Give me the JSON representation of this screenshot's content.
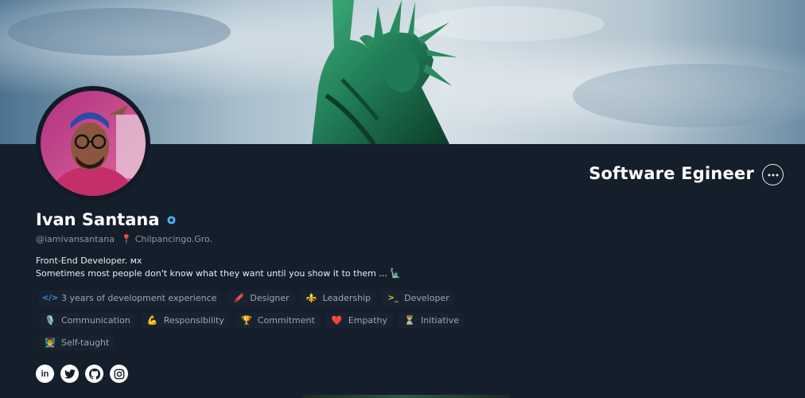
{
  "profile": {
    "name": "Ivan Santana",
    "handle": "@iamivansantana",
    "location": "Chilpancingo.Gro.",
    "role": "Software Egineer"
  },
  "bio": {
    "line1": "Front-End Developer. ᴍx",
    "line2": "Sometimes most people don't know what they want until you show it to them ... 🗽"
  },
  "badges_row1": [
    {
      "icon": "</>",
      "icon_name": "code-icon",
      "label": "3 years of development experience"
    },
    {
      "icon": "🖍️",
      "icon_name": "pencil-icon",
      "label": "Designer"
    },
    {
      "icon": "⚜️",
      "icon_name": "fleur-de-lis-icon",
      "label": "Leadership"
    },
    {
      "icon": ">_",
      "icon_name": "terminal-icon",
      "label": "Developer"
    }
  ],
  "badges_row2": [
    {
      "icon": "🎙️",
      "icon_name": "microphone-icon",
      "label": "Communication"
    },
    {
      "icon": "💪",
      "icon_name": "flexed-biceps-icon",
      "label": "Responsibility"
    },
    {
      "icon": "🏆",
      "icon_name": "trophy-icon",
      "label": "Commitment"
    },
    {
      "icon": "❤️",
      "icon_name": "heart-icon",
      "label": "Empathy"
    },
    {
      "icon": "⏳",
      "icon_name": "hourglass-icon",
      "label": "Initiative"
    }
  ],
  "badges_row3": [
    {
      "icon": "👨‍🏫",
      "icon_name": "teacher-icon",
      "label": "Self-taught"
    }
  ],
  "socials": [
    {
      "name": "linkedin-icon",
      "glyph": "in"
    },
    {
      "name": "twitter-icon",
      "glyph": ""
    },
    {
      "name": "github-icon",
      "glyph": ""
    },
    {
      "name": "instagram-icon",
      "glyph": ""
    }
  ],
  "colors": {
    "background": "#151f2b",
    "text": "#e8edf2",
    "muted": "#8b98a5",
    "verified": "#4ab3f4",
    "code_icon": "#3b8fe6",
    "terminal_icon": "#e2c62b"
  }
}
